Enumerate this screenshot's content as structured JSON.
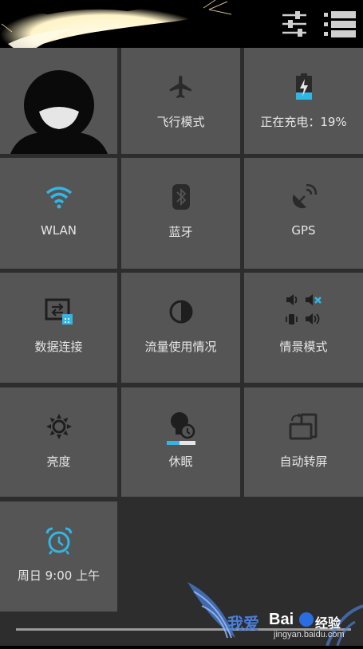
{
  "top_bar": {
    "settings_icon": "sliders-icon",
    "list_icon": "list-icon"
  },
  "tiles": [
    {
      "id": "profile",
      "label": "",
      "icon": "profile-avatar-icon"
    },
    {
      "id": "airplane",
      "label": "飞行模式",
      "icon": "airplane-icon"
    },
    {
      "id": "battery",
      "label": "正在充电：19%",
      "icon": "battery-charging-icon"
    },
    {
      "id": "wlan",
      "label": "WLAN",
      "icon": "wifi-icon"
    },
    {
      "id": "bluetooth",
      "label": "蓝牙",
      "icon": "bluetooth-icon"
    },
    {
      "id": "gps",
      "label": "GPS",
      "icon": "gps-icon"
    },
    {
      "id": "data",
      "label": "数据连接",
      "icon": "data-connection-icon"
    },
    {
      "id": "usage",
      "label": "流量使用情况",
      "icon": "data-usage-icon"
    },
    {
      "id": "profile_mode",
      "label": "情景模式",
      "icon": "sound-profile-icon"
    },
    {
      "id": "brightness",
      "label": "亮度",
      "icon": "brightness-icon"
    },
    {
      "id": "sleep",
      "label": "休眠",
      "icon": "sleep-icon"
    },
    {
      "id": "rotate",
      "label": "自动转屏",
      "icon": "auto-rotate-icon"
    },
    {
      "id": "alarm",
      "label": "周日 9:00 上午",
      "icon": "alarm-clock-icon"
    }
  ],
  "colors": {
    "accent_blue": "#33b5e5",
    "tile_bg": "#555555",
    "grid_bg": "#2d2d2d"
  },
  "watermark": {
    "brand": "Bai",
    "brand2": "经验",
    "url": "jingyan.baidu.com",
    "cn": "我爱"
  }
}
